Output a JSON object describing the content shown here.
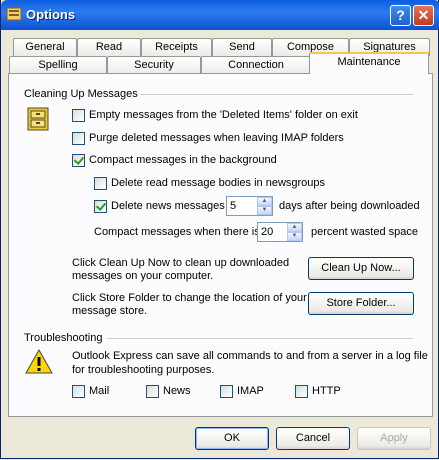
{
  "window": {
    "title": "Options",
    "help_label": "?",
    "close_label": "✕"
  },
  "tabs_row1": [
    "General",
    "Read",
    "Receipts",
    "Send",
    "Compose",
    "Signatures"
  ],
  "tabs_row2": [
    "Spelling",
    "Security",
    "Connection",
    "Maintenance"
  ],
  "active_tab": "Maintenance",
  "cleanup": {
    "group_label": "Cleaning Up Messages",
    "empty_deleted": {
      "label": "Empty messages from the 'Deleted Items' folder on exit",
      "checked": false
    },
    "purge_imap": {
      "label": "Purge deleted messages when leaving IMAP folders",
      "checked": false
    },
    "compact_bg": {
      "label": "Compact messages in the background",
      "checked": true
    },
    "delete_read_bodies": {
      "label": "Delete read message bodies in newsgroups",
      "checked": false
    },
    "delete_news": {
      "label": "Delete news messages",
      "checked": true,
      "days_value": "5",
      "suffix": "days after being downloaded"
    },
    "compact_when_prefix": "Compact messages when there is",
    "compact_when_value": "20",
    "compact_when_suffix": "percent wasted space",
    "cleanup_text_1": "Click Clean Up Now to clean up downloaded",
    "cleanup_text_2": "messages on your computer.",
    "cleanup_button": "Clean Up Now...",
    "store_text_1": "Click Store Folder to change the location of your",
    "store_text_2": "message store.",
    "store_button": "Store Folder..."
  },
  "troubleshooting": {
    "group_label": "Troubleshooting",
    "text_1": "Outlook Express can save all commands to and from a server in a log file",
    "text_2": "for troubleshooting purposes.",
    "options": [
      {
        "label": "Mail",
        "checked": false
      },
      {
        "label": "News",
        "checked": false
      },
      {
        "label": "IMAP",
        "checked": false
      },
      {
        "label": "HTTP",
        "checked": false
      }
    ]
  },
  "footer": {
    "ok": "OK",
    "cancel": "Cancel",
    "apply": "Apply"
  }
}
